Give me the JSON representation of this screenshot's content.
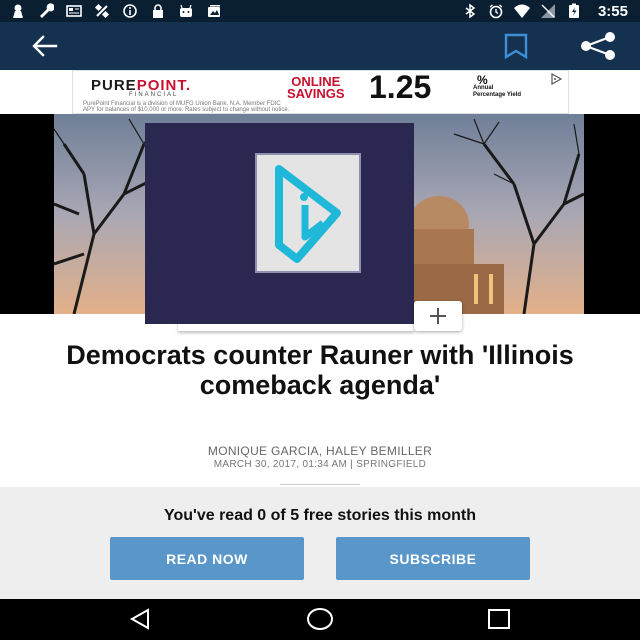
{
  "status_bar": {
    "time": "3:55",
    "icons_left": [
      "notification-icon",
      "wrench-icon",
      "newspaper-icon",
      "satellite-icon",
      "info-icon",
      "lock-icon",
      "android-icon",
      "photos-icon"
    ],
    "icons_right": [
      "bluetooth-icon",
      "alarm-icon",
      "wifi-icon",
      "signal-icon",
      "battery-icon"
    ],
    "background": "#0b1f33"
  },
  "app_bar": {
    "background": "#14324f",
    "actions": [
      "back-arrow-icon",
      "bookmark-icon",
      "share-icon"
    ]
  },
  "ad": {
    "brand_prefix": "PURE",
    "brand_accent": "POINT.",
    "brand_sub": "FINANCIAL",
    "offer_line1": "ONLINE",
    "offer_line2": "SAVINGS",
    "rate": "1.25",
    "percent": "%",
    "apy_line1": "Annual",
    "apy_line2": "Percentage Yield",
    "fine_print_1": "PurePoint Financial is a division of MUFG Union Bank, N.A. Member FDIC",
    "fine_print_2": "APY for balances of $10,000 or more. Rates subject to change without notice."
  },
  "hero": {
    "add_label": "+"
  },
  "article": {
    "headline": "Democrats counter Rauner with 'Illinois comeback agenda'",
    "authors": "MONIQUE GARCIA, HALEY BEMILLER",
    "dateline": "MARCH 30, 2017, 01:34 AM | SPRINGFIELD"
  },
  "paywall": {
    "message": "You've read 0 of 5 free stories this month",
    "read_now": "READ NOW",
    "subscribe": "SUBSCRIBE",
    "button_color": "#5996c9"
  },
  "nav_bar": {
    "buttons": [
      "nav-back-icon",
      "nav-home-icon",
      "nav-recents-icon"
    ]
  }
}
